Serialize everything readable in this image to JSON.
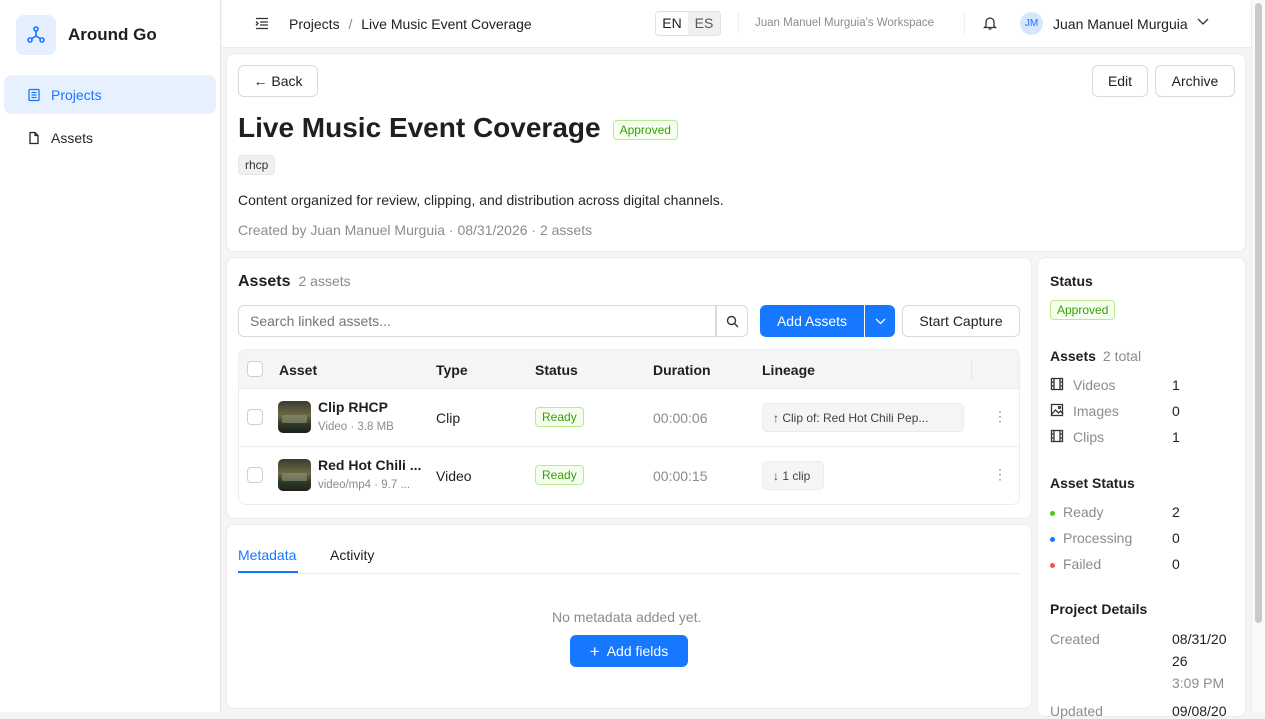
{
  "app": {
    "name": "Around Go"
  },
  "sidebar": {
    "items": [
      {
        "label": "Projects"
      },
      {
        "label": "Assets"
      }
    ]
  },
  "topbar": {
    "breadcrumb": {
      "root": "Projects",
      "separator": "/",
      "current": "Live Music Event Coverage"
    },
    "languages": [
      "EN",
      "ES"
    ],
    "workspace": "Juan Manuel Murguia's Workspace",
    "user": {
      "initials": "JM",
      "name": "Juan Manuel Murguia"
    }
  },
  "project": {
    "back_label": "← Back",
    "edit_label": "Edit",
    "archive_label": "Archive",
    "title": "Live Music Event Coverage",
    "status": "Approved",
    "tag": "rhcp",
    "description": "Content organized for review, clipping, and distribution across digital channels.",
    "meta": "Created by Juan Manuel Murguia · 08/31/2026 · 2 assets"
  },
  "assets_panel": {
    "title": "Assets",
    "count": "2 assets",
    "search_placeholder": "Search linked assets...",
    "add_label": "Add Assets",
    "capture_label": "Start Capture",
    "columns": [
      "Asset",
      "Type",
      "Status",
      "Duration",
      "Lineage"
    ],
    "rows": [
      {
        "name": "Clip RHCP",
        "sub": "Video · 3.8 MB",
        "type": "Clip",
        "status": "Ready",
        "duration": "00:00:06",
        "lineage": "↑ Clip of: Red Hot Chili Pep..."
      },
      {
        "name": "Red Hot Chili ...",
        "sub": "video/mp4 · 9.7 ...",
        "type": "Video",
        "status": "Ready",
        "duration": "00:00:15",
        "lineage": "↓ 1 clip"
      }
    ]
  },
  "details_tabs": {
    "tabs": [
      "Metadata",
      "Activity"
    ],
    "empty_text": "No metadata added yet.",
    "add_fields_label": "Add fields"
  },
  "right_panel": {
    "status_title": "Status",
    "status_value": "Approved",
    "assets_title": "Assets",
    "assets_total": "2 total",
    "asset_counts": [
      {
        "label": "Videos",
        "value": "1"
      },
      {
        "label": "Images",
        "value": "0"
      },
      {
        "label": "Clips",
        "value": "1"
      }
    ],
    "asset_status_title": "Asset Status",
    "asset_statuses": [
      {
        "label": "Ready",
        "value": "2",
        "color": "#52c41a"
      },
      {
        "label": "Processing",
        "value": "0",
        "color": "#1677ff"
      },
      {
        "label": "Failed",
        "value": "0",
        "color": "#ff4d4f"
      }
    ],
    "details_title": "Project Details",
    "created_label": "Created",
    "created_date_1": "08/31/20",
    "created_date_2": "26",
    "created_time": "3:09 PM",
    "updated_label": "Updated",
    "updated_date_1": "09/08/20"
  }
}
